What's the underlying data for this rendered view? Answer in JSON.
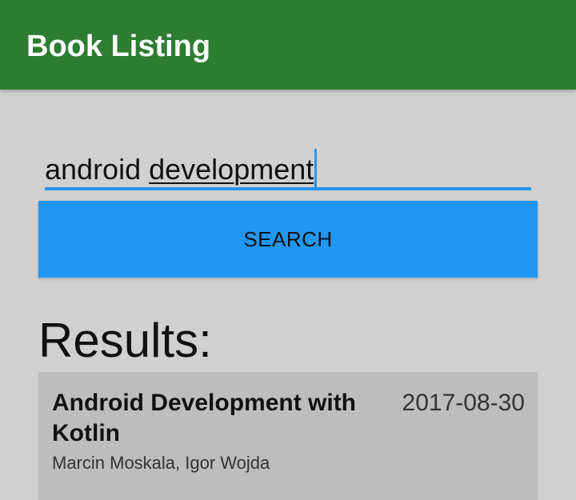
{
  "app_bar": {
    "title": "Book Listing",
    "color": "#2e7d32"
  },
  "search": {
    "query_prefix": "android ",
    "query_underlined": "development",
    "accent_color": "#2196f3",
    "button_label": "SEARCH"
  },
  "results": {
    "heading": "Results:",
    "items": [
      {
        "title": "Android Development with Kotlin",
        "date": "2017-08-30",
        "authors": "Marcin Moskala, Igor Wojda"
      }
    ]
  }
}
